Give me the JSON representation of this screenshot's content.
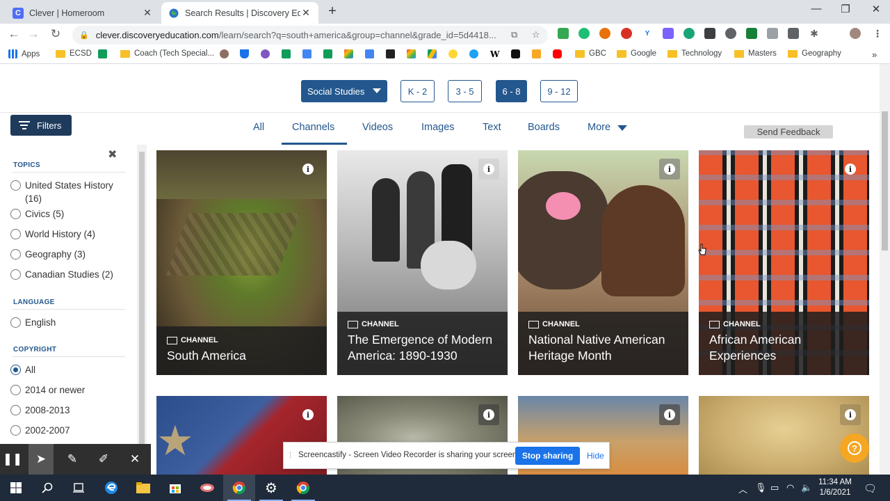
{
  "browser": {
    "tabs": [
      {
        "title": "Clever | Homeroom",
        "active": false
      },
      {
        "title": "Search Results | Discovery Educat",
        "active": true
      }
    ],
    "url_host": "clever.discoveryeducation.com",
    "url_path": "/learn/search?q=south+america&group=channel&grade_id=5d4418...",
    "bookmarks": [
      "Apps",
      "ECSD",
      "Coach (Tech Special...",
      "GBC",
      "Google",
      "Technology",
      "Masters",
      "Geography"
    ]
  },
  "subjects": {
    "dropdown_label": "Social Studies",
    "grades": [
      "K - 2",
      "3 - 5",
      "6 - 8",
      "9 - 12"
    ],
    "selected_grade": "6 - 8"
  },
  "filters": {
    "button_label": "Filters",
    "topics_heading": "TOPICS",
    "topics": [
      "United States History (16)",
      "Civics (5)",
      "World History (4)",
      "Geography (3)",
      "Canadian Studies (2)"
    ],
    "language_heading": "LANGUAGE",
    "languages": [
      "English"
    ],
    "copyright_heading": "COPYRIGHT",
    "copyright": [
      "All",
      "2014 or newer",
      "2008-2013",
      "2002-2007"
    ],
    "copyright_selected": "All"
  },
  "content_tabs": [
    "All",
    "Channels",
    "Videos",
    "Images",
    "Text",
    "Boards",
    "More"
  ],
  "active_tab": "Channels",
  "feedback_label": "Send Feedback",
  "cards": [
    {
      "type": "CHANNEL",
      "title": "South America"
    },
    {
      "type": "CHANNEL",
      "title": "The Emergence of Modern America: 1890-1930"
    },
    {
      "type": "CHANNEL",
      "title": "National Native American Heritage Month"
    },
    {
      "type": "CHANNEL",
      "title": "African American Experiences"
    }
  ],
  "screencastify": {
    "message": "Screencastify - Screen Video Recorder is sharing your screen.",
    "stop_label": "Stop sharing",
    "hide_label": "Hide"
  },
  "taskbar": {
    "time": "11:34 AM",
    "date": "1/6/2021"
  },
  "colors": {
    "brand_blue": "#23578e",
    "filters_navy": "#1f3b5c",
    "help_orange": "#f5a623"
  }
}
